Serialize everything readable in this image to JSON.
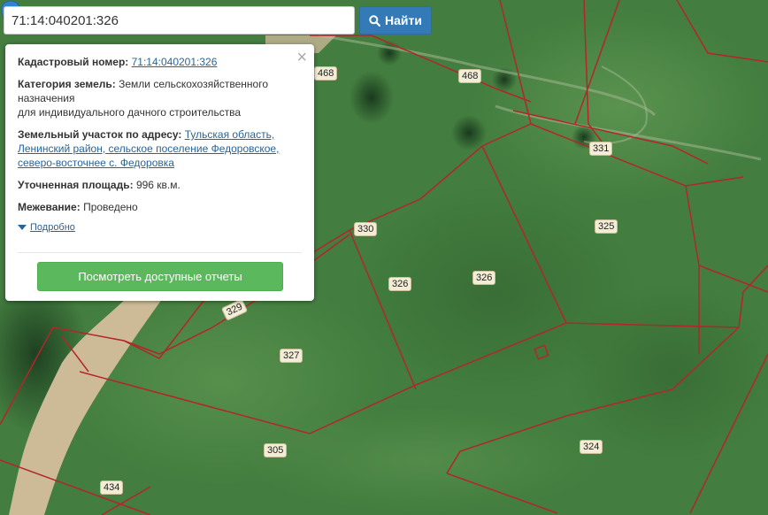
{
  "search": {
    "value": "71:14:040201:326",
    "button_label": "Найти"
  },
  "popup": {
    "cadastral_label": "Кадастровый номер:",
    "cadastral_value": "71:14:040201:326",
    "category_label": "Категория земель:",
    "category_value_1": "Земли сельскохозяйственного назначения",
    "category_value_2": "для индивидуального дачного строительства",
    "address_label": "Земельный участок по адресу:",
    "address_value": "Тульская область, Ленинский район, сельское поселение Федоровское, северо-восточнее с. Федоровка",
    "area_label": "Уточненная площадь:",
    "area_value": "996 кв.м.",
    "survey_label": "Межевание:",
    "survey_value": "Проведено",
    "more_label": "Подробно",
    "close_symbol": "×",
    "reports_button": "Посмотреть доступные отчеты"
  },
  "map": {
    "plot_labels": [
      "468",
      "468",
      "331",
      "325",
      "330",
      "326",
      "326",
      "329",
      "327",
      "305",
      "324",
      "434"
    ],
    "boundary_color": "#b3262a",
    "marker_color": "#2f86d0"
  }
}
